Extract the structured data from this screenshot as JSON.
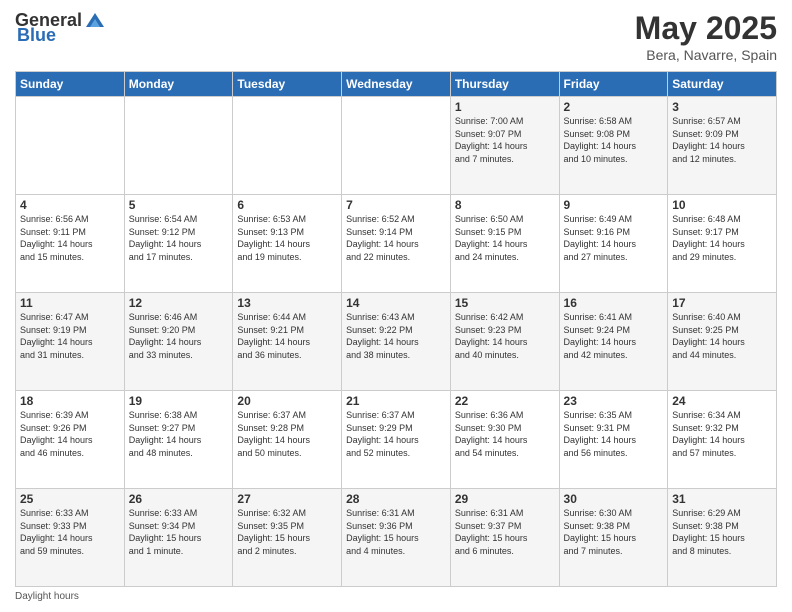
{
  "header": {
    "logo_general": "General",
    "logo_blue": "Blue",
    "month_title": "May 2025",
    "location": "Bera, Navarre, Spain"
  },
  "days_of_week": [
    "Sunday",
    "Monday",
    "Tuesday",
    "Wednesday",
    "Thursday",
    "Friday",
    "Saturday"
  ],
  "footer_note": "Daylight hours",
  "weeks": [
    [
      {
        "day": "",
        "info": ""
      },
      {
        "day": "",
        "info": ""
      },
      {
        "day": "",
        "info": ""
      },
      {
        "day": "",
        "info": ""
      },
      {
        "day": "1",
        "info": "Sunrise: 7:00 AM\nSunset: 9:07 PM\nDaylight: 14 hours\nand 7 minutes."
      },
      {
        "day": "2",
        "info": "Sunrise: 6:58 AM\nSunset: 9:08 PM\nDaylight: 14 hours\nand 10 minutes."
      },
      {
        "day": "3",
        "info": "Sunrise: 6:57 AM\nSunset: 9:09 PM\nDaylight: 14 hours\nand 12 minutes."
      }
    ],
    [
      {
        "day": "4",
        "info": "Sunrise: 6:56 AM\nSunset: 9:11 PM\nDaylight: 14 hours\nand 15 minutes."
      },
      {
        "day": "5",
        "info": "Sunrise: 6:54 AM\nSunset: 9:12 PM\nDaylight: 14 hours\nand 17 minutes."
      },
      {
        "day": "6",
        "info": "Sunrise: 6:53 AM\nSunset: 9:13 PM\nDaylight: 14 hours\nand 19 minutes."
      },
      {
        "day": "7",
        "info": "Sunrise: 6:52 AM\nSunset: 9:14 PM\nDaylight: 14 hours\nand 22 minutes."
      },
      {
        "day": "8",
        "info": "Sunrise: 6:50 AM\nSunset: 9:15 PM\nDaylight: 14 hours\nand 24 minutes."
      },
      {
        "day": "9",
        "info": "Sunrise: 6:49 AM\nSunset: 9:16 PM\nDaylight: 14 hours\nand 27 minutes."
      },
      {
        "day": "10",
        "info": "Sunrise: 6:48 AM\nSunset: 9:17 PM\nDaylight: 14 hours\nand 29 minutes."
      }
    ],
    [
      {
        "day": "11",
        "info": "Sunrise: 6:47 AM\nSunset: 9:19 PM\nDaylight: 14 hours\nand 31 minutes."
      },
      {
        "day": "12",
        "info": "Sunrise: 6:46 AM\nSunset: 9:20 PM\nDaylight: 14 hours\nand 33 minutes."
      },
      {
        "day": "13",
        "info": "Sunrise: 6:44 AM\nSunset: 9:21 PM\nDaylight: 14 hours\nand 36 minutes."
      },
      {
        "day": "14",
        "info": "Sunrise: 6:43 AM\nSunset: 9:22 PM\nDaylight: 14 hours\nand 38 minutes."
      },
      {
        "day": "15",
        "info": "Sunrise: 6:42 AM\nSunset: 9:23 PM\nDaylight: 14 hours\nand 40 minutes."
      },
      {
        "day": "16",
        "info": "Sunrise: 6:41 AM\nSunset: 9:24 PM\nDaylight: 14 hours\nand 42 minutes."
      },
      {
        "day": "17",
        "info": "Sunrise: 6:40 AM\nSunset: 9:25 PM\nDaylight: 14 hours\nand 44 minutes."
      }
    ],
    [
      {
        "day": "18",
        "info": "Sunrise: 6:39 AM\nSunset: 9:26 PM\nDaylight: 14 hours\nand 46 minutes."
      },
      {
        "day": "19",
        "info": "Sunrise: 6:38 AM\nSunset: 9:27 PM\nDaylight: 14 hours\nand 48 minutes."
      },
      {
        "day": "20",
        "info": "Sunrise: 6:37 AM\nSunset: 9:28 PM\nDaylight: 14 hours\nand 50 minutes."
      },
      {
        "day": "21",
        "info": "Sunrise: 6:37 AM\nSunset: 9:29 PM\nDaylight: 14 hours\nand 52 minutes."
      },
      {
        "day": "22",
        "info": "Sunrise: 6:36 AM\nSunset: 9:30 PM\nDaylight: 14 hours\nand 54 minutes."
      },
      {
        "day": "23",
        "info": "Sunrise: 6:35 AM\nSunset: 9:31 PM\nDaylight: 14 hours\nand 56 minutes."
      },
      {
        "day": "24",
        "info": "Sunrise: 6:34 AM\nSunset: 9:32 PM\nDaylight: 14 hours\nand 57 minutes."
      }
    ],
    [
      {
        "day": "25",
        "info": "Sunrise: 6:33 AM\nSunset: 9:33 PM\nDaylight: 14 hours\nand 59 minutes."
      },
      {
        "day": "26",
        "info": "Sunrise: 6:33 AM\nSunset: 9:34 PM\nDaylight: 15 hours\nand 1 minute."
      },
      {
        "day": "27",
        "info": "Sunrise: 6:32 AM\nSunset: 9:35 PM\nDaylight: 15 hours\nand 2 minutes."
      },
      {
        "day": "28",
        "info": "Sunrise: 6:31 AM\nSunset: 9:36 PM\nDaylight: 15 hours\nand 4 minutes."
      },
      {
        "day": "29",
        "info": "Sunrise: 6:31 AM\nSunset: 9:37 PM\nDaylight: 15 hours\nand 6 minutes."
      },
      {
        "day": "30",
        "info": "Sunrise: 6:30 AM\nSunset: 9:38 PM\nDaylight: 15 hours\nand 7 minutes."
      },
      {
        "day": "31",
        "info": "Sunrise: 6:29 AM\nSunset: 9:38 PM\nDaylight: 15 hours\nand 8 minutes."
      }
    ]
  ]
}
